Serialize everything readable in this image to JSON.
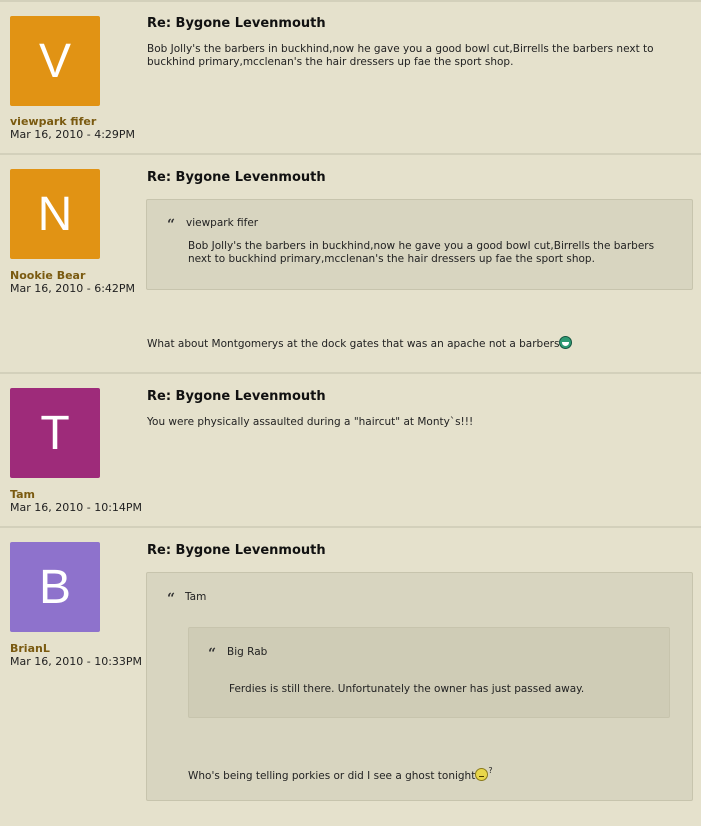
{
  "posts": [
    {
      "avatar_letter": "V",
      "avatar_color": "#e19314",
      "username": "viewpark fifer",
      "date": "Mar 16, 2010 - 4:29PM",
      "title": "Re: Bygone Levenmouth",
      "body": "Bob Jolly's the barbers in buckhind,now he gave you a good bowl cut,Birrells the barbers next to buckhind primary,mcclenan's the hair dressers up fae the sport shop."
    },
    {
      "avatar_letter": "N",
      "avatar_color": "#e19314",
      "username": "Nookie Bear",
      "date": "Mar 16, 2010 - 6:42PM",
      "title": "Re: Bygone Levenmouth",
      "quote_author": "viewpark fifer",
      "quote_text": "Bob Jolly's the barbers in buckhind,now he gave you a good bowl cut,Birrells the barbers next to buckhind primary,mcclenan's the hair dressers up fae the sport shop.",
      "body": "What about Montgomerys at the dock gates that was an apache not a barbers",
      "smiley": "grin-icon"
    },
    {
      "avatar_letter": "T",
      "avatar_color": "#9e2b7a",
      "username": "Tam",
      "date": "Mar 16, 2010 - 10:14PM",
      "title": "Re: Bygone Levenmouth",
      "body": "You were physically assaulted during a \"haircut\" at Monty`s!!!"
    },
    {
      "avatar_letter": "B",
      "avatar_color": "#8e72cc",
      "username": "BrianL",
      "date": "Mar 16, 2010 - 10:33PM",
      "title": "Re: Bygone Levenmouth",
      "quote_author": "Tam",
      "inner_quote_author": "Big Rab",
      "inner_quote_text": "Ferdies is still there. Unfortunately the owner has just passed away.",
      "quote_text": "Who's being telling porkies or did I see a ghost tonight",
      "smiley": "thinking-icon",
      "smiley_suffix": "?"
    }
  ],
  "quote_mark": "“"
}
